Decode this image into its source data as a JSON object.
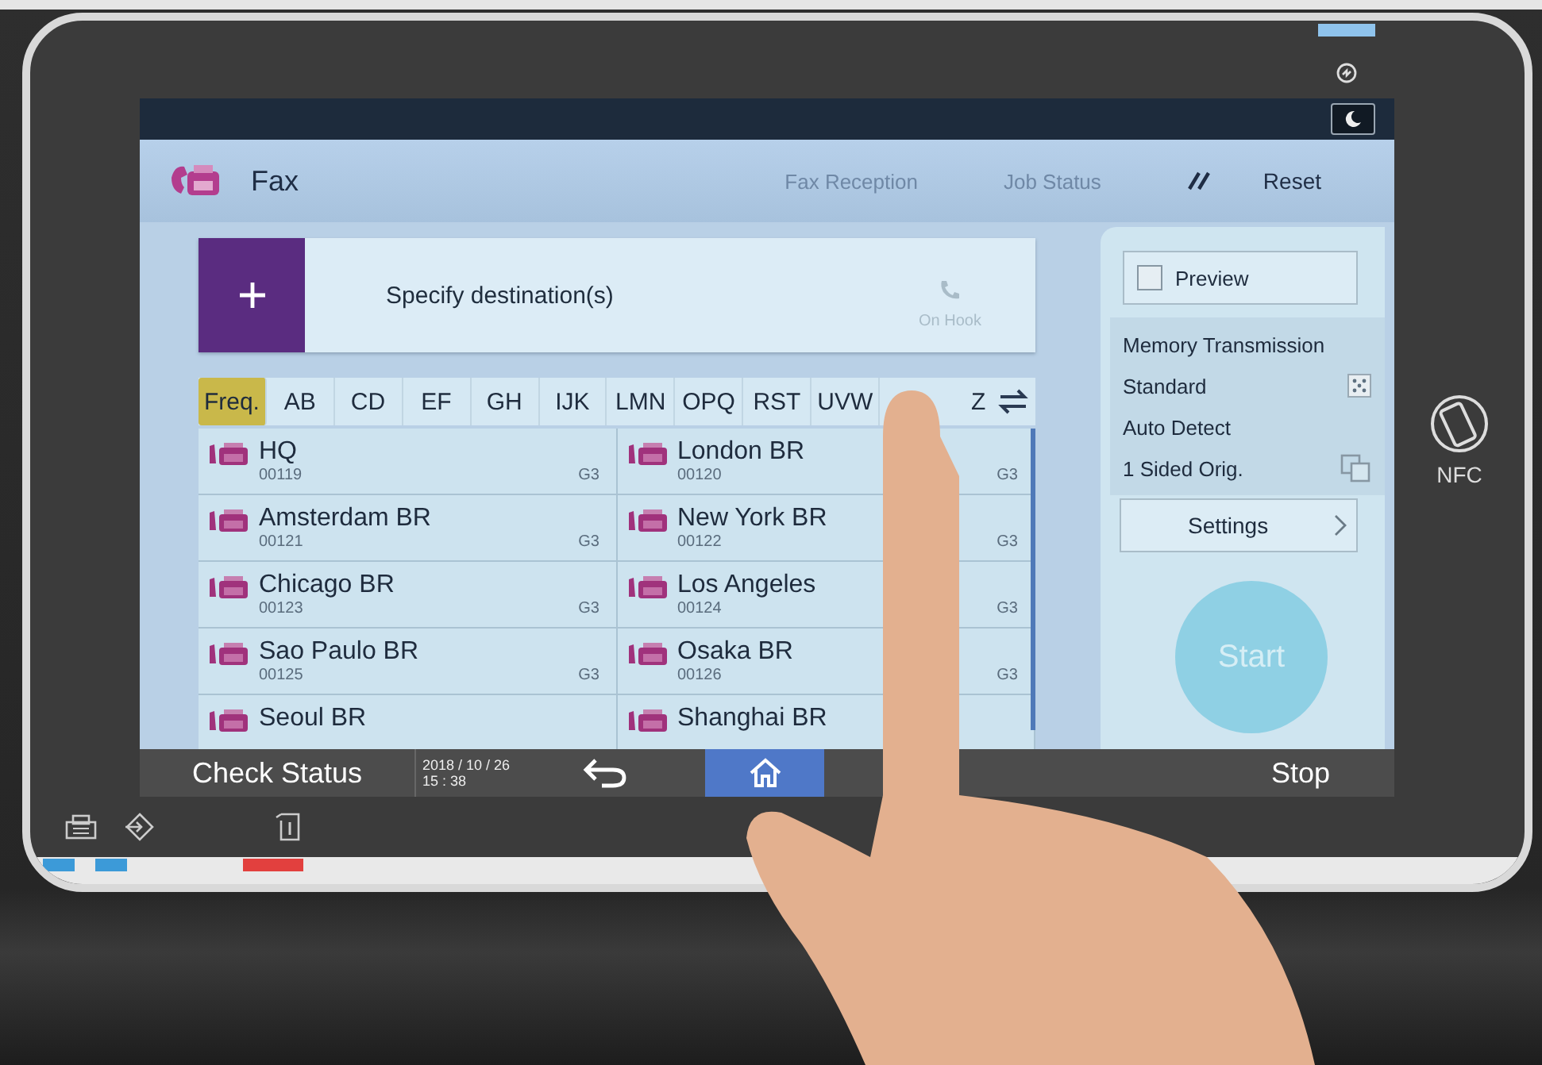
{
  "header": {
    "title": "Fax",
    "links": [
      {
        "label": "Fax Reception"
      },
      {
        "label": "Job Status"
      }
    ],
    "reset": "Reset"
  },
  "destination": {
    "label": "Specify destination(s)",
    "on_hook": "On Hook"
  },
  "index_tabs": [
    {
      "label": "Freq.",
      "selected": true
    },
    {
      "label": "AB",
      "selected": false
    },
    {
      "label": "CD",
      "selected": false
    },
    {
      "label": "EF",
      "selected": false
    },
    {
      "label": "GH",
      "selected": false
    },
    {
      "label": "IJK",
      "selected": false
    },
    {
      "label": "LMN",
      "selected": false
    },
    {
      "label": "OPQ",
      "selected": false
    },
    {
      "label": "RST",
      "selected": false
    },
    {
      "label": "UVW",
      "selected": false
    },
    {
      "label": "Z",
      "selected": false
    }
  ],
  "destinations": [
    {
      "name": "HQ",
      "number": "00119",
      "mode": "G3"
    },
    {
      "name": "London BR",
      "number": "00120",
      "mode": "G3"
    },
    {
      "name": "Amsterdam BR",
      "number": "00121",
      "mode": "G3"
    },
    {
      "name": "New York BR",
      "number": "00122",
      "mode": "G3"
    },
    {
      "name": "Chicago BR",
      "number": "00123",
      "mode": "G3"
    },
    {
      "name": "Los Angeles",
      "number": "00124",
      "mode": "G3"
    },
    {
      "name": "Sao Paulo BR",
      "number": "00125",
      "mode": "G3"
    },
    {
      "name": "Osaka BR",
      "number": "00126",
      "mode": "G3"
    },
    {
      "name": "Seoul BR"
    },
    {
      "name": "Shanghai BR"
    }
  ],
  "panel": {
    "preview": {
      "label": "Preview",
      "checked": false
    },
    "summary": [
      {
        "label": "Memory Transmission",
        "kind": "plain"
      },
      {
        "label": "Standard",
        "kind": "resolution"
      },
      {
        "label": "Auto Detect",
        "kind": "plain"
      },
      {
        "label": "1 Sided Orig.",
        "kind": "sides"
      }
    ],
    "settings": "Settings",
    "start": {
      "label": "Start",
      "disabled": true
    }
  },
  "status_bar": {
    "check_status": "Check Status",
    "date": "2018 / 10 / 26",
    "time": "15 : 38",
    "stop": "Stop"
  },
  "nfc": "NFC"
}
